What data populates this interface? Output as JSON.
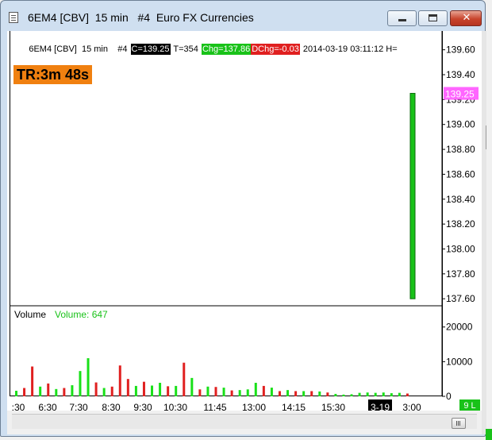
{
  "window": {
    "title": "6EM4 [CBV]  15 min   #4  Euro FX Currencies",
    "buttons": {
      "minimize": "",
      "maximize": "",
      "close": "✕"
    }
  },
  "infobar": {
    "symbol": "6EM4 [CBV]  15 min    #4 ",
    "close": "C=139.25",
    "ticks": " T=354 ",
    "chg": "Chg=137.86",
    "dchg": "DChg=-0.03",
    "datetime": " 2014-03-19 03:11:12 H="
  },
  "timer_badge": "TR:3m 48s",
  "price_axis": {
    "ticks": [
      "139.60",
      "139.40",
      "139.20",
      "139.00",
      "138.80",
      "138.60",
      "138.40",
      "138.20",
      "138.00",
      "137.80",
      "137.60"
    ],
    "current_price": "139.25",
    "current_color": "#ff66ff"
  },
  "volume_panel": {
    "label": "Volume",
    "value_label": "Volume: 647",
    "axis_ticks": [
      "20000",
      "10000",
      "0"
    ]
  },
  "time_axis": {
    "labels": [
      ":30",
      "6:30",
      "7:30",
      "8:30",
      "9:30",
      "10:30",
      "11:45",
      "13:00",
      "14:15",
      "15:30",
      "3-19",
      "3:00"
    ],
    "highlight": "3-19"
  },
  "status_badge": "9 L",
  "colors": {
    "up": "#19e019",
    "down": "#e02020",
    "accent": "#f08010"
  },
  "chart_data": {
    "type": "bar",
    "price_bar": {
      "open": 137.6,
      "close": 139.25,
      "color": "#19c219"
    },
    "ylim": [
      137.55,
      139.7
    ],
    "volume": {
      "ylim": [
        0,
        22000
      ],
      "values": [
        1600,
        2400,
        8600,
        2800,
        3700,
        2100,
        2400,
        3200,
        7300,
        11000,
        4000,
        2400,
        2800,
        8900,
        5000,
        3000,
        4200,
        3100,
        3900,
        2900,
        3000,
        9700,
        5300,
        2000,
        2800,
        2700,
        2500,
        1700,
        1800,
        2000,
        3900,
        3000,
        2500,
        1500,
        1800,
        1500,
        1500,
        1500,
        1400,
        1100,
        700,
        500,
        600,
        1000,
        1100,
        1000,
        1100,
        900,
        1000,
        800
      ],
      "colors": [
        "up",
        "down",
        "down",
        "up",
        "down",
        "up",
        "down",
        "up",
        "up",
        "up",
        "down",
        "up",
        "down",
        "down",
        "down",
        "up",
        "down",
        "up",
        "up",
        "down",
        "up",
        "down",
        "up",
        "down",
        "up",
        "down",
        "up",
        "down",
        "up",
        "up",
        "up",
        "down",
        "up",
        "down",
        "up",
        "down",
        "up",
        "down",
        "up",
        "down",
        "up",
        "up",
        "up",
        "up",
        "up",
        "up",
        "up",
        "up",
        "up",
        "down"
      ]
    }
  }
}
